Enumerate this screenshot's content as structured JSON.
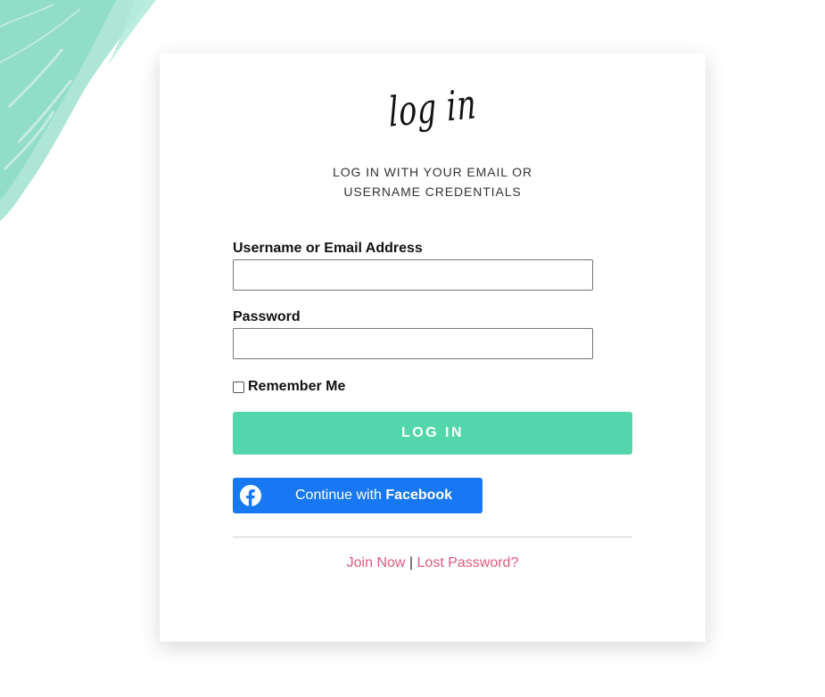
{
  "header": {
    "script_title": "log in",
    "subtitle_line1": "LOG IN WITH YOUR EMAIL OR",
    "subtitle_line2": "USERNAME CREDENTIALS"
  },
  "form": {
    "username_label": "Username or Email Address",
    "username_value": "",
    "password_label": "Password",
    "password_value": "",
    "remember_label": "Remember Me",
    "remember_checked": false,
    "login_button_label": "LOG IN"
  },
  "facebook": {
    "label_prefix": "Continue with ",
    "label_brand": "Facebook",
    "icon": "facebook-icon"
  },
  "footer_links": {
    "join": "Join Now",
    "separator": "|",
    "lost_password": "Lost Password?"
  },
  "colors": {
    "accent": "#54d6ac",
    "facebook_blue": "#1877f2",
    "link_pink": "#e0577f",
    "brush_mint": "#8fdcc8"
  }
}
